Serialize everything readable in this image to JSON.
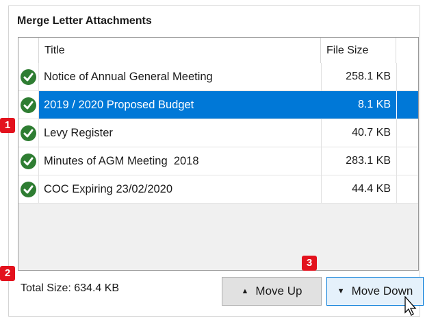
{
  "panel": {
    "title": "Merge Letter Attachments"
  },
  "grid": {
    "columns": [
      "Title",
      "File Size"
    ],
    "rows": [
      {
        "title": "Notice of Annual General Meeting",
        "size": "258.1 KB",
        "selected": false
      },
      {
        "title": "2019 / 2020 Proposed Budget",
        "size": "8.1 KB",
        "selected": true
      },
      {
        "title": "Levy Register",
        "size": "40.7 KB",
        "selected": false
      },
      {
        "title": "Minutes of AGM Meeting  2018",
        "size": "283.1 KB",
        "selected": false
      },
      {
        "title": "COC Expiring 23/02/2020",
        "size": "44.4 KB",
        "selected": false
      }
    ]
  },
  "footer": {
    "total_size": "Total Size:  634.4 KB",
    "move_up_label": "Move Up",
    "move_down_label": "Move Down"
  },
  "badges": [
    "1",
    "2",
    "3"
  ],
  "colors": {
    "selection": "#0078d7",
    "badge": "#e3121d",
    "check": "#2e7d32"
  },
  "icons": {
    "row_status": "check-circle-icon",
    "up": "triangle-up-icon",
    "down": "triangle-down-icon"
  }
}
